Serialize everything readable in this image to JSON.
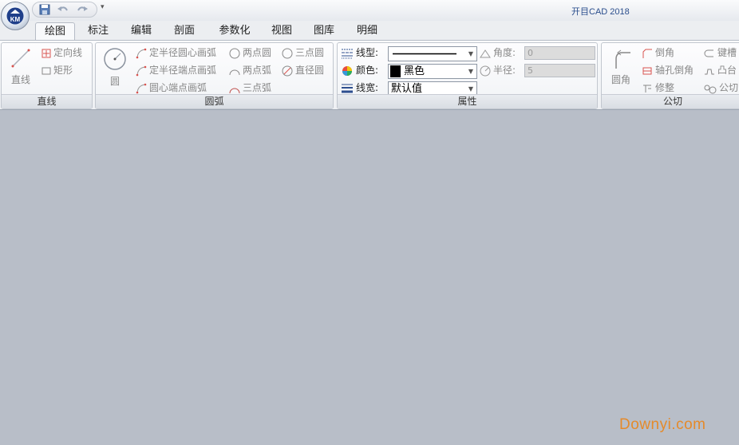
{
  "app": {
    "title": "开目CAD 2018",
    "logo_text": "KM",
    "qat_more": "▾"
  },
  "tabs": [
    {
      "label": "绘图",
      "active": true
    },
    {
      "label": "标注"
    },
    {
      "label": "编辑"
    },
    {
      "label": "剖面"
    },
    {
      "label": "参数化"
    },
    {
      "label": "视图"
    },
    {
      "label": "图库"
    },
    {
      "label": "明细"
    }
  ],
  "groups": {
    "line": {
      "label": "直线",
      "big_button": "直线",
      "items": [
        "定向线",
        "矩形"
      ]
    },
    "arc": {
      "label": "圆弧",
      "big_button": "圆",
      "items": [
        "定半径圆心画弧",
        "定半径端点画弧",
        "圆心端点画弧",
        "两点圆",
        "两点弧",
        "三点弧",
        "三点圆",
        "直径圆"
      ]
    },
    "attributes": {
      "label": "属性",
      "linetype_label": "线型:",
      "color_label": "颜色:",
      "color_value": "黑色",
      "linewidth_label": "线宽:",
      "linewidth_value": "默认值",
      "angle_label": "角度:",
      "angle_value": "0",
      "radius_label": "半径:",
      "radius_value": "5"
    },
    "tangent": {
      "label": "公切",
      "big_button": "圆角",
      "items": [
        "倒角",
        "轴孔倒角",
        "修整",
        "键槽",
        "凸台",
        "公切"
      ]
    }
  },
  "watermark": "Downyi.com",
  "colors": {
    "canvas": "#b8bec8",
    "title_text": "#2a4d8c",
    "icon_red": "#d9534f",
    "watermark": "#e58a2a"
  }
}
